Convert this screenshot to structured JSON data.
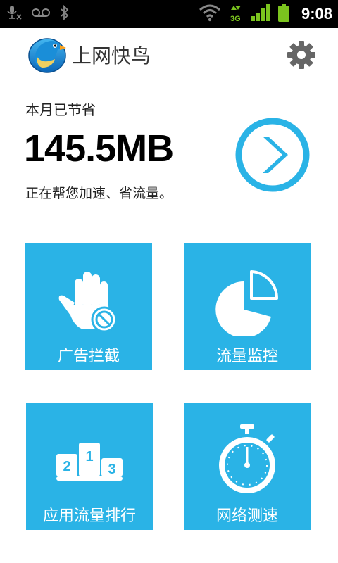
{
  "status_bar": {
    "time": "9:08",
    "network_type": "3G",
    "icons": [
      "mic-muted-icon",
      "voicemail-icon",
      "bluetooth-icon",
      "wifi-icon",
      "data-arrows-icon",
      "signal-icon",
      "battery-icon"
    ]
  },
  "header": {
    "title": "上网快鸟",
    "logo_icon": "bird-logo-icon",
    "settings_icon": "gear-icon"
  },
  "savings": {
    "label": "本月已节省",
    "value": "145.5MB",
    "description": "正在帮您加速、省流量。"
  },
  "tiles": [
    {
      "label": "广告拦截",
      "icon": "hand-block-icon"
    },
    {
      "label": "流量监控",
      "icon": "pie-chart-icon"
    },
    {
      "label": "应用流量排行",
      "icon": "podium-icon"
    },
    {
      "label": "网络测速",
      "icon": "stopwatch-icon"
    }
  ],
  "colors": {
    "accent": "#2ab3e6",
    "status_bar_bg": "#000000",
    "signal_green": "#7bc41e"
  }
}
